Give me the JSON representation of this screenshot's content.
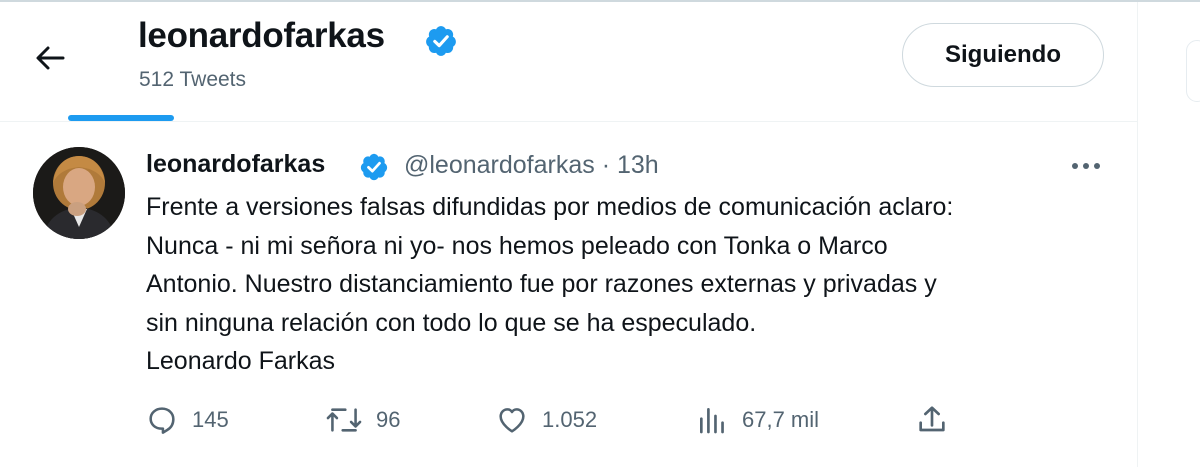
{
  "header": {
    "account_name": "leonardofarkas",
    "tweet_count": "512 Tweets",
    "follow_label": "Siguiendo"
  },
  "tweet": {
    "display_name": "leonardofarkas",
    "handle_time": "@leonardofarkas · 13h",
    "text_lines": [
      "Frente a versiones falsas difundidas por medios de comunicación aclaro:",
      "Nunca - ni mi señora ni yo- nos hemos peleado con Tonka o Marco",
      "Antonio. Nuestro distanciamiento fue por razones externas y privadas y",
      "sin ninguna relación con todo lo que se ha especulado.",
      "Leonardo Farkas"
    ],
    "actions": {
      "replies": "145",
      "retweets": "96",
      "likes": "1.052",
      "views": "67,7 mil"
    }
  },
  "icons": {
    "back": "arrow-left-icon",
    "verified": "verified-badge-icon",
    "more": "more-dots-icon",
    "reply": "reply-icon",
    "retweet": "retweet-icon",
    "like": "heart-icon",
    "views": "views-bar-chart-icon",
    "share": "share-icon"
  },
  "colors": {
    "accent": "#1d9bf0",
    "text": "#0f1419",
    "secondary_text": "#536471",
    "border": "#cfd9de"
  }
}
